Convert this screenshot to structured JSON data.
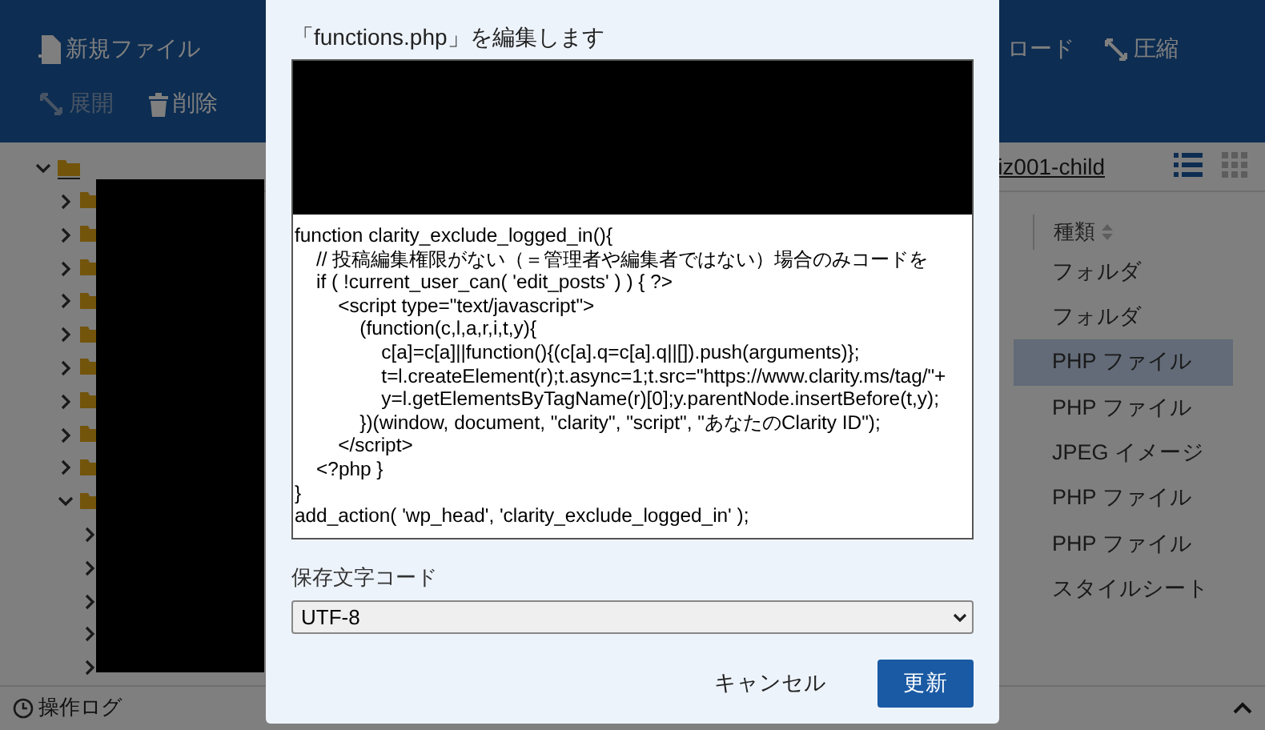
{
  "toolbar": {
    "row_1": [
      {
        "label": "新規ファイル",
        "kind": "file"
      },
      {
        "label": "ロード",
        "kind": "none"
      },
      {
        "label": "圧縮",
        "kind": "compress"
      }
    ],
    "row_2": [
      {
        "label": "展開",
        "kind": "expand",
        "disabled": true
      },
      {
        "label": "削除",
        "kind": "trash",
        "disabled": false
      }
    ]
  },
  "breadcrumb": "iz001-child",
  "view_modes": [
    {
      "kind": "list",
      "selected": true
    },
    {
      "kind": "grid",
      "selected": false
    }
  ],
  "tree": [
    {
      "expanded": true,
      "kind": "root",
      "children": [
        {
          "expanded": false
        },
        {
          "expanded": false
        },
        {
          "expanded": false
        },
        {
          "expanded": false
        },
        {
          "expanded": false
        },
        {
          "expanded": false
        },
        {
          "expanded": false
        },
        {
          "expanded": false
        },
        {
          "expanded": false
        },
        {
          "expanded": true,
          "children": [
            {
              "expanded": false
            },
            {
              "expanded": false
            },
            {
              "expanded": false
            },
            {
              "expanded": false
            },
            {
              "expanded": false
            }
          ]
        }
      ]
    }
  ],
  "type_column": {
    "header": "種類",
    "rows": [
      {
        "label": "フォルダ",
        "selected": false
      },
      {
        "label": "フォルダ",
        "selected": false
      },
      {
        "label": "PHP ファイル",
        "selected": true
      },
      {
        "label": "PHP ファイル",
        "selected": false
      },
      {
        "label": "JPEG イメージ",
        "selected": false
      },
      {
        "label": "PHP ファイル",
        "selected": false
      },
      {
        "label": "PHP ファイル",
        "selected": false
      },
      {
        "label": "スタイルシート",
        "selected": false
      }
    ]
  },
  "footer": {
    "label": "操作ログ"
  },
  "dialog": {
    "title": "「functions.php」を編集します",
    "code_lines": [
      "function clarity_exclude_logged_in(){",
      "    // 投稿編集権限がない（＝管理者や編集者ではない）場合のみコードを",
      "    if ( !current_user_can( 'edit_posts' ) ) { ?>",
      "        <script type=\"text/javascript\">",
      "            (function(c,l,a,r,i,t,y){",
      "                c[a]=c[a]||function(){(c[a].q=c[a].q||[]).push(arguments)};",
      "                t=l.createElement(r);t.async=1;t.src=\"https://www.clarity.ms/tag/\"+",
      "                y=l.getElementsByTagName(r)[0];y.parentNode.insertBefore(t,y);",
      "            })(window, document, \"clarity\", \"script\", \"あなたのClarity ID\");",
      "        </script>",
      "    <?php }",
      "}",
      "add_action( 'wp_head', 'clarity_exclude_logged_in' );"
    ],
    "encoding_label": "保存文字コード",
    "encoding": "UTF-8",
    "buttons": [
      {
        "label": "キャンセル",
        "kind": "secondary"
      },
      {
        "label": "更新",
        "kind": "primary"
      }
    ]
  }
}
